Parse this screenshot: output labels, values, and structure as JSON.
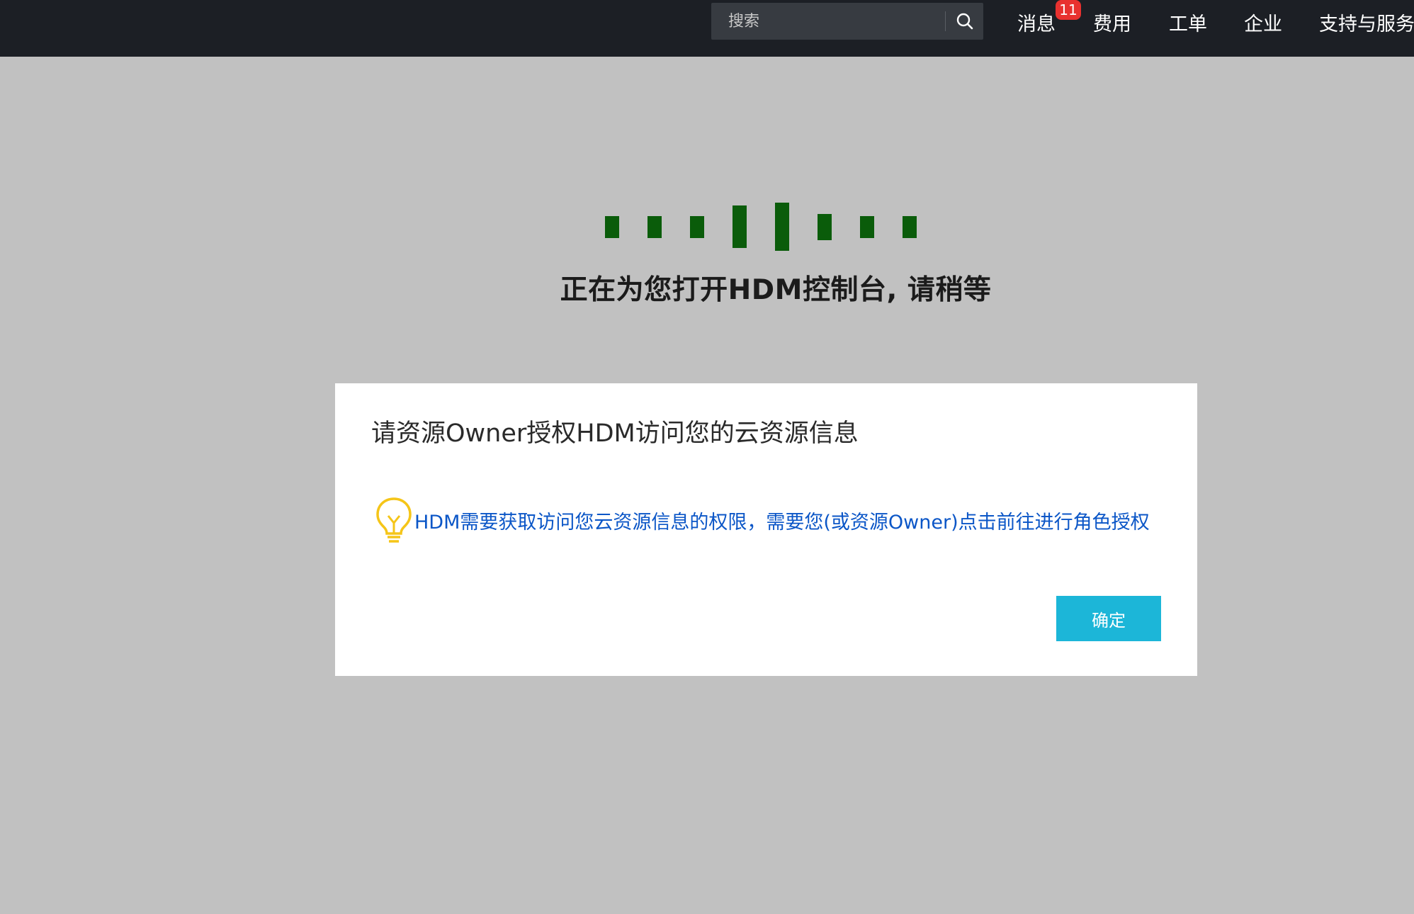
{
  "topbar": {
    "search": {
      "placeholder": "搜索",
      "icon": "search-icon"
    },
    "nav": [
      {
        "label": "消息",
        "badge": "11"
      },
      {
        "label": "费用"
      },
      {
        "label": "工单"
      },
      {
        "label": "企业"
      },
      {
        "label": "支持与服务"
      }
    ]
  },
  "loading": {
    "message": "正在为您打开HDM控制台, 请稍等",
    "color": "#0a5c0a"
  },
  "dialog": {
    "title": "请资源Owner授权HDM访问您的云资源信息",
    "message": "HDM需要获取访问您云资源信息的权限，需要您(或资源Owner)点击前往进行角色授权",
    "icon": "lightbulb-icon",
    "icon_color": "#f5c518",
    "confirm_label": "确定",
    "confirm_color": "#1cb6d8"
  }
}
